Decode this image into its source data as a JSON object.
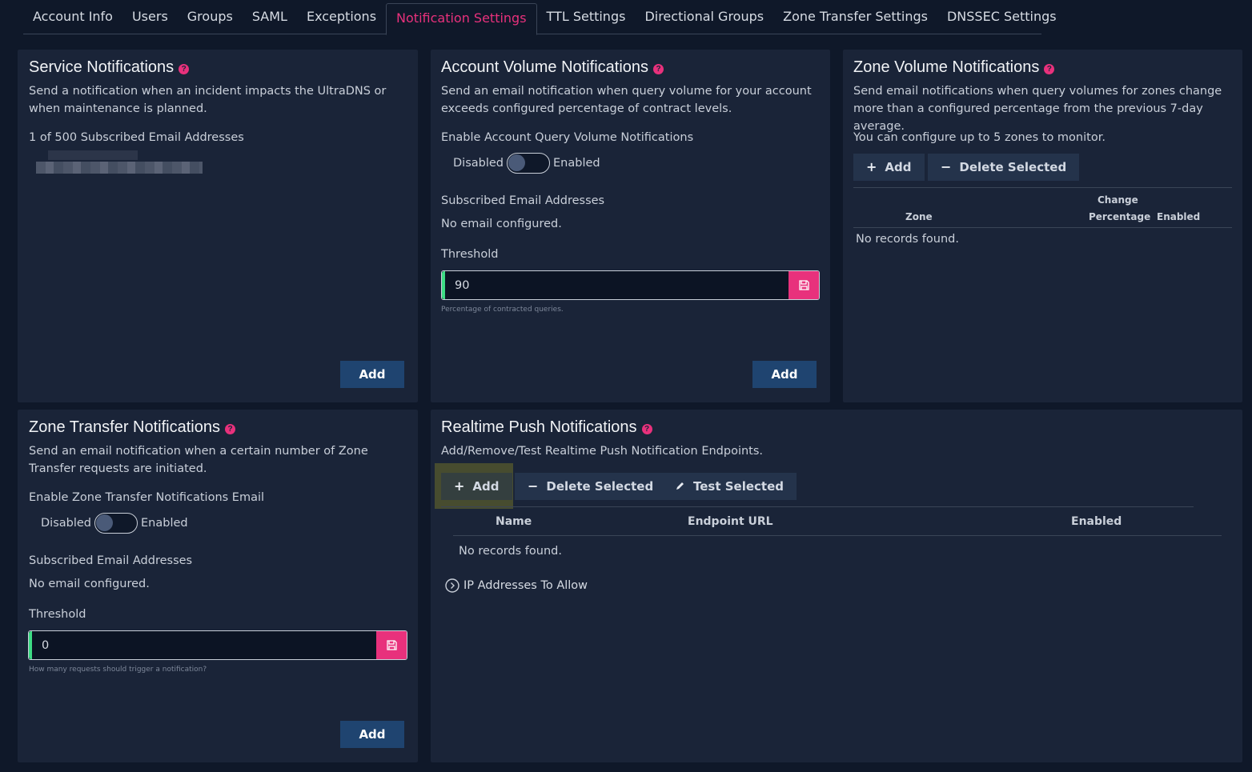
{
  "tabs": [
    {
      "label": "Account Info"
    },
    {
      "label": "Users"
    },
    {
      "label": "Groups"
    },
    {
      "label": "SAML"
    },
    {
      "label": "Exceptions"
    },
    {
      "label": "Notification Settings",
      "active": true
    },
    {
      "label": "TTL Settings"
    },
    {
      "label": "Directional Groups"
    },
    {
      "label": "Zone Transfer Settings"
    },
    {
      "label": "DNSSEC Settings"
    }
  ],
  "service": {
    "title": "Service Notifications",
    "desc": "Send a notification when an incident impacts the UltraDNS or when maintenance is planned.",
    "count": "1 of 500 Subscribed Email Addresses",
    "add": "Add"
  },
  "account_volume": {
    "title": "Account Volume Notifications",
    "desc": "Send an email notification when query volume for your account exceeds configured percentage of contract levels.",
    "enable_label": "Enable Account Query Volume Notifications",
    "disabled": "Disabled",
    "enabled": "Enabled",
    "subscribed": "Subscribed Email Addresses",
    "no_email": "No email configured.",
    "threshold": "Threshold",
    "threshold_value": "90",
    "hint": "Percentage of contracted queries.",
    "add": "Add"
  },
  "zone_volume": {
    "title": "Zone Volume Notifications",
    "desc": "Send email notifications when query volumes for zones change more than a configured percentage from the previous 7-day average.",
    "limit": "You can configure up to 5 zones to monitor.",
    "add": "Add",
    "delete": "Delete Selected",
    "col_zone": "Zone",
    "col_change_1": "Change",
    "col_change_2": "Percentage",
    "col_enabled": "Enabled",
    "empty": "No records found."
  },
  "zone_transfer": {
    "title": "Zone Transfer Notifications",
    "desc": "Send an email notification when a certain number of Zone Transfer requests are initiated.",
    "enable_label": "Enable Zone Transfer Notifications Email",
    "disabled": "Disabled",
    "enabled": "Enabled",
    "subscribed": "Subscribed Email Addresses",
    "no_email": "No email configured.",
    "threshold": "Threshold",
    "threshold_value": "0",
    "hint": "How many requests should trigger a notification?",
    "add": "Add"
  },
  "realtime": {
    "title": "Realtime Push Notifications",
    "desc": "Add/Remove/Test Realtime Push Notification Endpoints.",
    "add": "Add",
    "delete": "Delete Selected",
    "test": "Test Selected",
    "col_name": "Name",
    "col_url": "Endpoint URL",
    "col_enabled": "Enabled",
    "empty": "No records found.",
    "ip_allow": "IP Addresses To Allow"
  },
  "colors": {
    "accent": "#e8317c",
    "button": "#1f4470",
    "panel": "#1a2438",
    "background": "#0f1829",
    "input_ok": "#3ddc84"
  }
}
